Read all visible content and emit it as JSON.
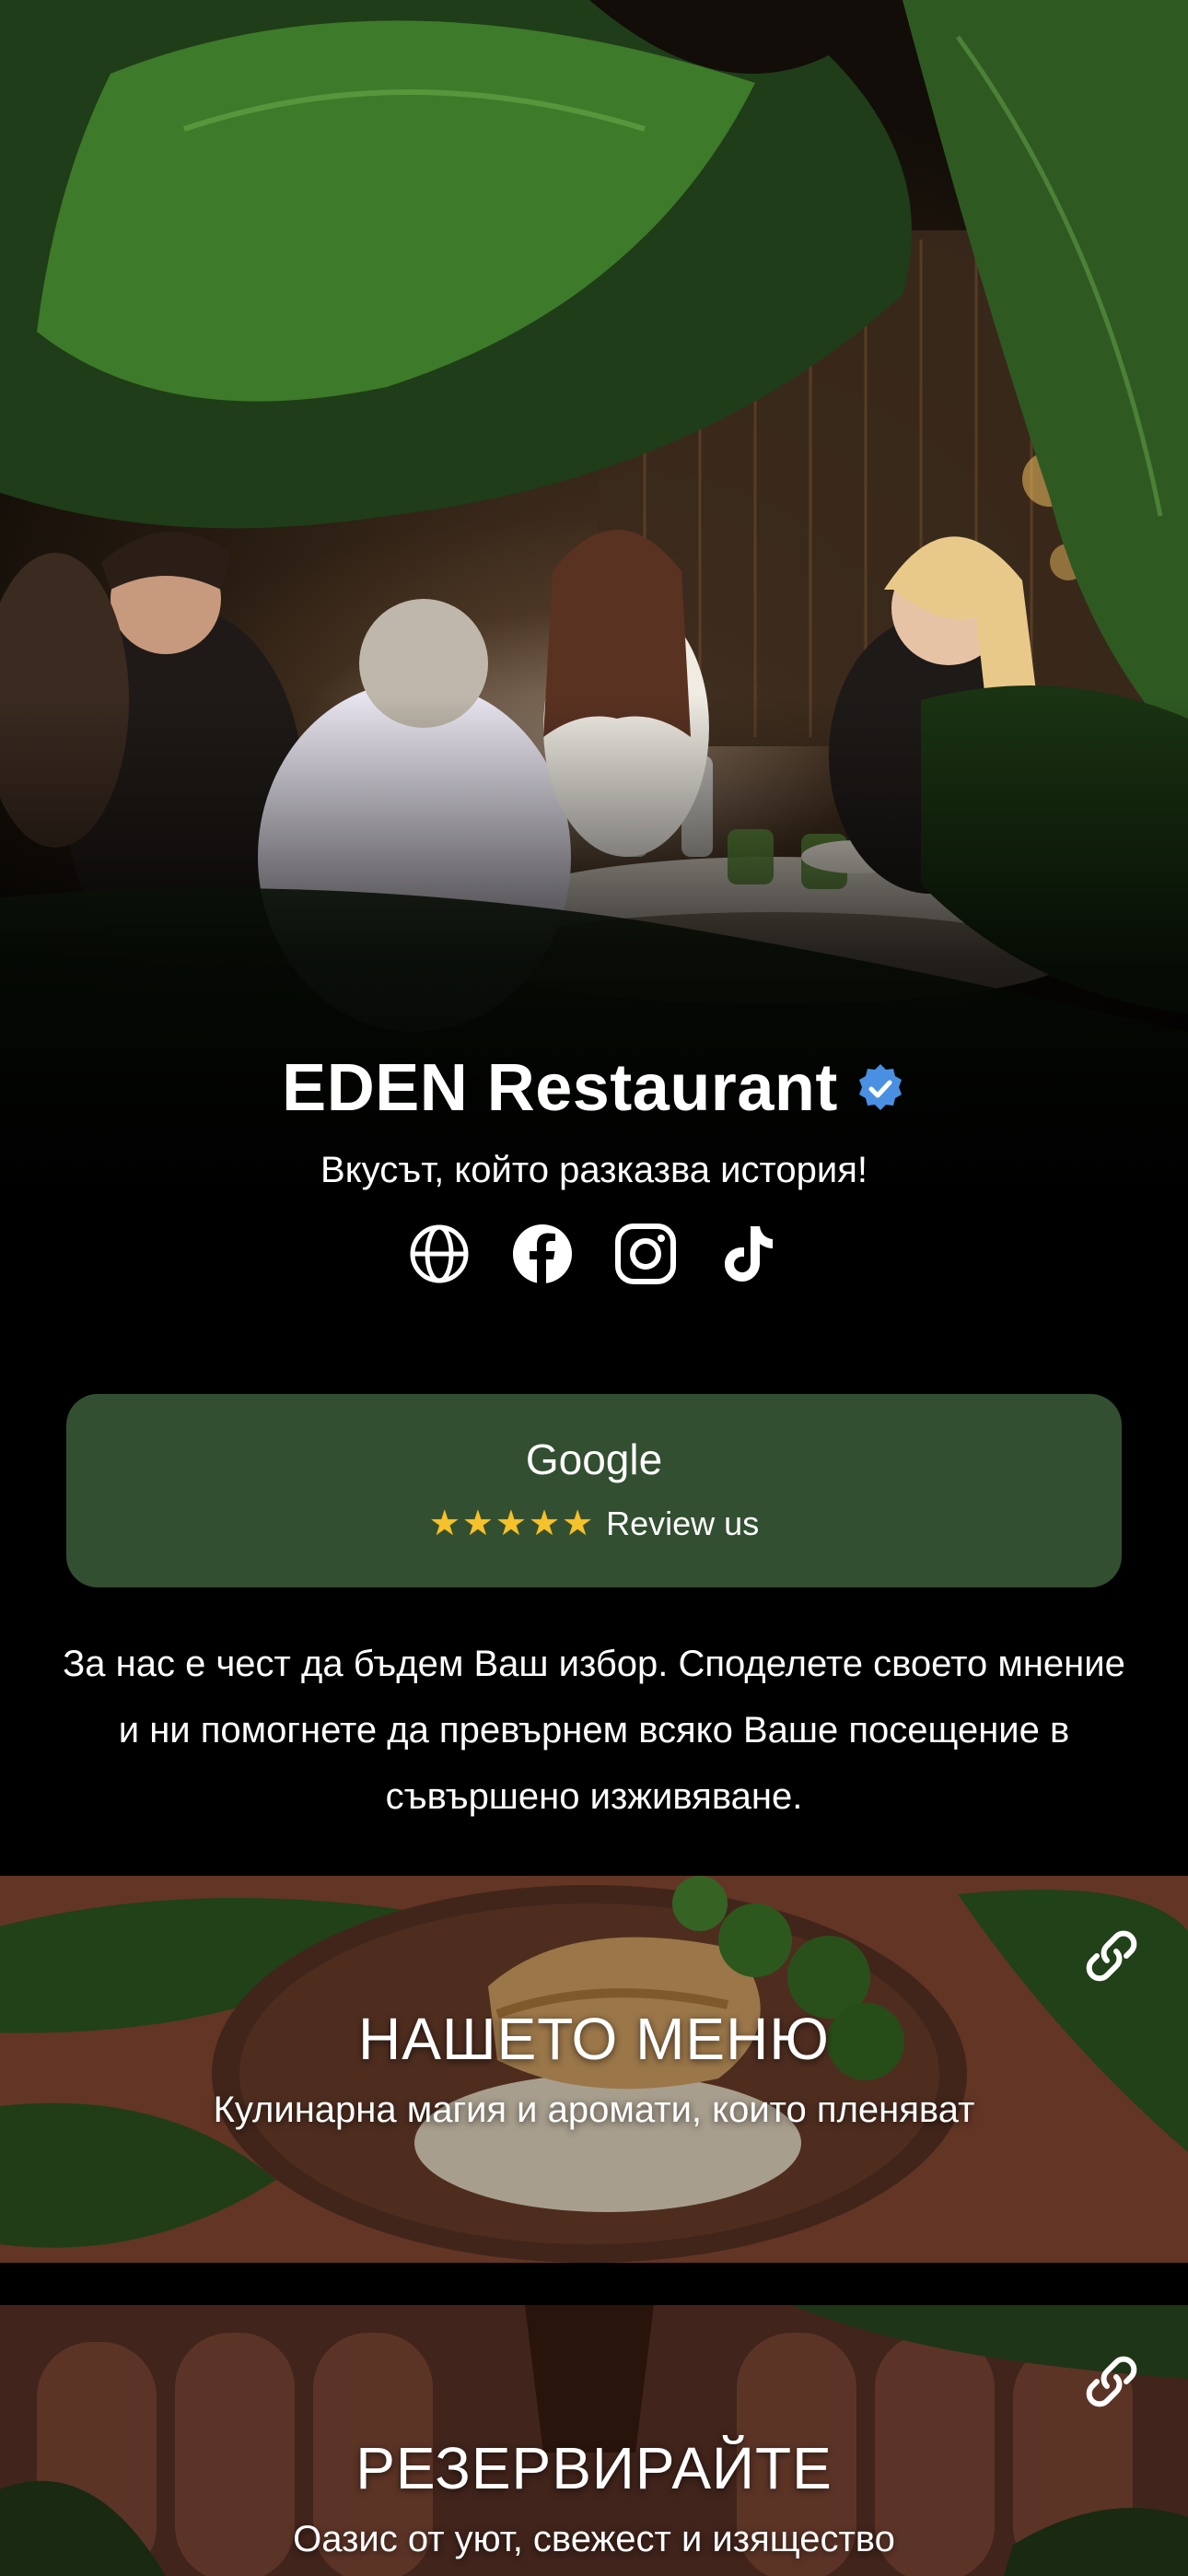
{
  "profile": {
    "name": "EDEN Restaurant",
    "tagline": "Вкусът, който разказва история!",
    "socials": [
      "website-icon",
      "facebook-icon",
      "instagram-icon",
      "tiktok-icon"
    ]
  },
  "review": {
    "title": "Google",
    "stars": "★★★★★",
    "label": "Review us"
  },
  "about": "За нас е чест да бъдем Ваш избор. Споделете своето мнение и ни помогнете да превърнем всяко Ваше посещение в съвършено изживяване.",
  "cards": [
    {
      "title": "НАШЕТО МЕНЮ",
      "subtitle": "Кулинарна магия и аромати, които пленяват"
    },
    {
      "title": "РЕЗЕРВИРАЙТЕ",
      "subtitle": "Оазис от уют, свежест и изящество"
    }
  ],
  "colors": {
    "background": "#000000",
    "review_button": "#334f31",
    "verified_badge": "#4a90e2",
    "stars": "#f5c22c"
  }
}
